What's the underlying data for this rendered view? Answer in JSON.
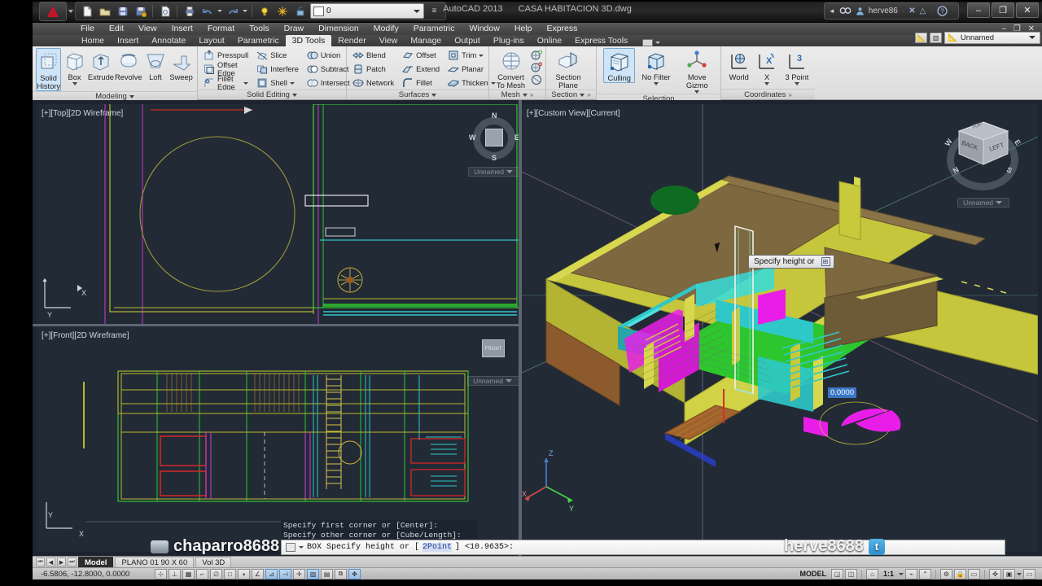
{
  "titlebar": {
    "app_name": "AutoCAD 2013",
    "document_name": "CASA HABITACION 3D.dwg",
    "user_name": "herve86",
    "quick_access": [
      {
        "name": "new-icon",
        "glyph": "🗋"
      },
      {
        "name": "open-icon",
        "glyph": "🗁"
      },
      {
        "name": "save-icon",
        "glyph": "💾"
      },
      {
        "name": "save-as-icon",
        "glyph": "💾"
      },
      {
        "name": "plot-preview-icon",
        "glyph": "🖹"
      },
      {
        "name": "plot-icon",
        "glyph": "🖨"
      },
      {
        "name": "undo-icon",
        "glyph": "↩"
      },
      {
        "name": "redo-icon",
        "glyph": "↪"
      }
    ],
    "layer_value": "0",
    "window_buttons": [
      {
        "name": "minimize-button",
        "glyph": "–"
      },
      {
        "name": "maximize-button",
        "glyph": "❐"
      },
      {
        "name": "close-button",
        "glyph": "✕"
      }
    ],
    "inner_window_buttons": "– ❐ ✕"
  },
  "menubar": {
    "items": [
      "File",
      "Edit",
      "View",
      "Insert",
      "Format",
      "Tools",
      "Draw",
      "Dimension",
      "Modify",
      "Parametric",
      "Window",
      "Help",
      "Express"
    ]
  },
  "ribbon_tabs": {
    "items": [
      "Home",
      "Insert",
      "Annotate",
      "Layout",
      "Parametric",
      "3D Tools",
      "Render",
      "View",
      "Manage",
      "Output",
      "Plug-ins",
      "Online",
      "Express Tools"
    ],
    "active": "3D Tools"
  },
  "workspace": {
    "name": "Unnamed"
  },
  "ribbon": {
    "panels": [
      {
        "name": "Modeling",
        "title": "Modeling",
        "big_buttons": [
          {
            "label": "Solid\nHistory",
            "line1": "Solid",
            "line2": "History",
            "icon": "solid-history-icon",
            "selected": true,
            "dropdown": false
          },
          {
            "label": "Box",
            "line1": "Box",
            "line2": "",
            "icon": "box-icon",
            "selected": false,
            "dropdown": true
          },
          {
            "label": "Extrude",
            "line1": "Extrude",
            "line2": "",
            "icon": "extrude-icon",
            "selected": false,
            "dropdown": false
          },
          {
            "label": "Revolve",
            "line1": "Revolve",
            "line2": "",
            "icon": "revolve-icon",
            "selected": false,
            "dropdown": false
          },
          {
            "label": "Loft",
            "line1": "Loft",
            "line2": "",
            "icon": "loft-icon",
            "selected": false,
            "dropdown": false
          },
          {
            "label": "Sweep",
            "line1": "Sweep",
            "line2": "",
            "icon": "sweep-icon",
            "selected": false,
            "dropdown": false
          }
        ]
      },
      {
        "name": "Solid Editing",
        "title": "Solid Editing",
        "columns": [
          [
            {
              "label": "Presspull",
              "icon": "presspull-icon",
              "dropdown": false
            },
            {
              "label": "Offset Edge",
              "icon": "offset-edge-icon",
              "dropdown": false
            },
            {
              "label": "Fillet Edge",
              "icon": "fillet-edge-icon",
              "dropdown": true
            }
          ],
          [
            {
              "label": "Slice",
              "icon": "slice-icon",
              "dropdown": false
            },
            {
              "label": "Interfere",
              "icon": "interfere-icon",
              "dropdown": false
            },
            {
              "label": "Shell",
              "icon": "shell-icon",
              "dropdown": true
            }
          ],
          [
            {
              "label": "Union",
              "icon": "union-icon",
              "dropdown": false
            },
            {
              "label": "Subtract",
              "icon": "subtract-icon",
              "dropdown": false
            },
            {
              "label": "Intersect",
              "icon": "intersect-icon",
              "dropdown": false
            }
          ]
        ]
      },
      {
        "name": "Surfaces",
        "title": "Surfaces",
        "columns": [
          [
            {
              "label": "Blend",
              "icon": "blend-icon",
              "dropdown": false
            },
            {
              "label": "Patch",
              "icon": "patch-icon",
              "dropdown": false
            },
            {
              "label": "Network",
              "icon": "network-icon",
              "dropdown": false
            }
          ],
          [
            {
              "label": "Offset",
              "icon": "surface-offset-icon",
              "dropdown": false
            },
            {
              "label": "Extend",
              "icon": "extend-icon",
              "dropdown": false
            },
            {
              "label": "Fillet",
              "icon": "surface-fillet-icon",
              "dropdown": false
            }
          ],
          [
            {
              "label": "Trim",
              "icon": "trim-icon",
              "dropdown": true
            },
            {
              "label": "Planar",
              "icon": "planar-icon",
              "dropdown": false
            },
            {
              "label": "Thicken",
              "icon": "thicken-icon",
              "dropdown": true
            }
          ]
        ]
      },
      {
        "name": "Mesh",
        "title": "Mesh",
        "big_buttons": [
          {
            "line1": "Convert",
            "line2": "To Mesh",
            "icon": "convert-to-mesh-icon",
            "selected": false,
            "dropdown": false
          }
        ],
        "side_icons": [
          {
            "name": "smooth-more-icon"
          },
          {
            "name": "smooth-less-icon"
          },
          {
            "name": "refine-mesh-icon"
          }
        ]
      },
      {
        "name": "Section",
        "title": "Section",
        "big_buttons": [
          {
            "line1": "Section",
            "line2": "Plane",
            "icon": "section-plane-icon",
            "selected": false,
            "dropdown": false
          }
        ]
      },
      {
        "name": "Selection",
        "title": "Selection",
        "big_buttons": [
          {
            "line1": "Culling",
            "line2": "",
            "icon": "culling-icon",
            "selected": true,
            "dropdown": false
          },
          {
            "line1": "No Filter",
            "line2": "",
            "icon": "no-filter-icon",
            "selected": false,
            "dropdown": true
          },
          {
            "line1": "Move Gizmo",
            "line2": "",
            "icon": "move-gizmo-icon",
            "selected": false,
            "dropdown": true
          }
        ]
      },
      {
        "name": "Coordinates",
        "title": "Coordinates",
        "big_buttons": [
          {
            "line1": "World",
            "line2": "",
            "icon": "ucs-world-icon",
            "selected": false,
            "dropdown": false
          },
          {
            "line1": "X",
            "line2": "",
            "icon": "ucs-x-icon",
            "selected": false,
            "dropdown": true
          },
          {
            "line1": "3 Point",
            "line2": "",
            "icon": "ucs-3point-icon",
            "selected": false,
            "dropdown": true
          }
        ]
      }
    ]
  },
  "viewports": [
    {
      "name": "top-viewport",
      "label": "[+][Top][2D Wireframe]",
      "viewcube_label": "Unnamed"
    },
    {
      "name": "front-viewport",
      "label": "[+][Front][2D Wireframe]",
      "viewcube_label": "Unnamed"
    },
    {
      "name": "model-3d-viewport",
      "label": "[+][Custom View][Current]",
      "viewcube_label": "Unnamed"
    }
  ],
  "viewcube": {
    "compass": [
      "N",
      "E",
      "S",
      "W"
    ],
    "faces_3d": [
      "TOP",
      "BACK",
      "LEFT"
    ],
    "compass_3d": [
      "N",
      "W",
      "E",
      "S"
    ]
  },
  "dynamic_input": {
    "tooltip": "Specify height or",
    "tooltip_expand_glyph": "⊞",
    "value": "0.0000"
  },
  "command_line": {
    "history": [
      "Specify first corner or [Center]:",
      "Specify other corner or [Cube/Length]:"
    ],
    "prompt_prefix": "BOX Specify height or [",
    "prompt_keyword": "2Point",
    "prompt_suffix": "] <10.9635>:"
  },
  "model_tabs": {
    "nav": [
      "⏮",
      "◀",
      "▶",
      "⏭"
    ],
    "items": [
      "Model",
      "PLANO 01 90 X 60",
      "Vol 3D"
    ],
    "active": "Model"
  },
  "status_bar": {
    "coordinates": "-6.5806, -12.8000, 0.0000",
    "left_toggles": [
      {
        "name": "infer-constraints-toggle",
        "glyph": "⊹",
        "on": false
      },
      {
        "name": "snap-mode-toggle",
        "glyph": "⊥",
        "on": false
      },
      {
        "name": "grid-display-toggle",
        "glyph": "▦",
        "on": false
      },
      {
        "name": "ortho-mode-toggle",
        "glyph": "⌐",
        "on": false
      },
      {
        "name": "polar-tracking-toggle",
        "glyph": "∅",
        "on": false
      },
      {
        "name": "object-snap-toggle",
        "glyph": "□",
        "on": false
      },
      {
        "name": "3d-object-snap-toggle",
        "glyph": "◖",
        "on": false
      },
      {
        "name": "object-snap-tracking-toggle",
        "glyph": "∠",
        "on": false
      },
      {
        "name": "allow-ucs-toggle",
        "glyph": "⊿",
        "on": true
      },
      {
        "name": "dynamic-input-toggle",
        "glyph": "⊣",
        "on": true
      },
      {
        "name": "lineweight-toggle",
        "glyph": "✛",
        "on": false
      },
      {
        "name": "transparency-toggle",
        "glyph": "▨",
        "on": true
      },
      {
        "name": "quick-properties-toggle",
        "glyph": "▤",
        "on": false
      },
      {
        "name": "selection-cycling-toggle",
        "glyph": "⧉",
        "on": false
      },
      {
        "name": "annotation-monitor-toggle",
        "glyph": "✥",
        "on": true
      }
    ],
    "model_label": "MODEL",
    "scale": "1:1",
    "right_toggles": [
      {
        "name": "model-space-icon",
        "glyph": "◲"
      },
      {
        "name": "layout-space-icon",
        "glyph": "◫"
      },
      {
        "name": "annotation-scale-icon",
        "glyph": "⌂"
      },
      {
        "name": "annotation-visibility-icon",
        "glyph": "⌁"
      },
      {
        "name": "auto-scale-icon",
        "glyph": "⌃"
      },
      {
        "name": "workspace-switch-icon",
        "glyph": "⚙"
      },
      {
        "name": "lock-toolbars-icon",
        "glyph": "🔒"
      },
      {
        "name": "hardware-accel-icon",
        "glyph": "▭"
      },
      {
        "name": "isolate-objects-icon",
        "glyph": "✜"
      },
      {
        "name": "clean-screen-icon",
        "glyph": "▣"
      }
    ]
  },
  "watermarks": {
    "left": "chaparro8688",
    "right": "herve8688",
    "right_icon": "twitter-icon",
    "right_icon_glyph": "t"
  },
  "colors": {
    "canvas_bg": "#222a36",
    "ribbon_bg": "#e4e4e4",
    "accent_selected": "#cfe4f7",
    "roof_brown": "#8a7346",
    "wall_yellow": "#c9c93f",
    "floor_green": "#2ec62e",
    "magenta": "#e81ee8",
    "cyan": "#2fc8c8",
    "dark_green": "#0f6b21"
  }
}
